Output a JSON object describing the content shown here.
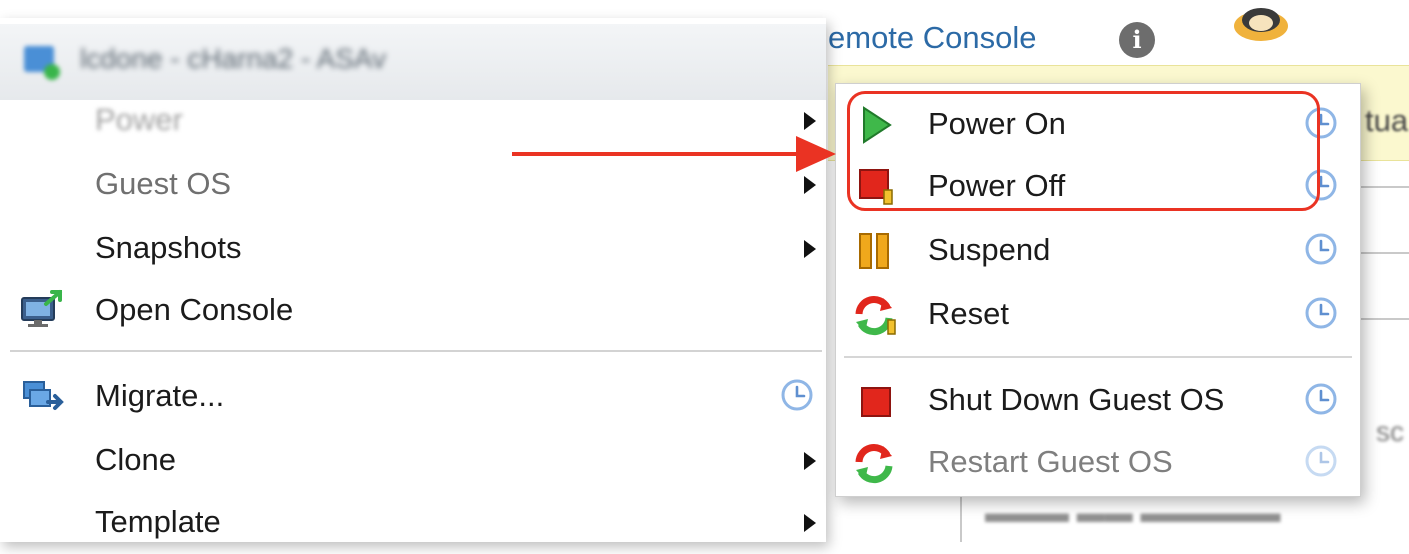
{
  "background": {
    "console_link": "emote Console",
    "info_icon": "info-circle-icon",
    "avatar_icon": "user-avatar-icon",
    "banner_text_fragment": "tua",
    "faded_text_fragment": "sc"
  },
  "context_menu": {
    "header": {
      "vm_icon": "virtual-machine-icon",
      "title": "lcdone - cHarna2 - ASAv"
    },
    "items": [
      {
        "label": "Power",
        "has_submenu": true,
        "state": "blurred"
      },
      {
        "label": "Guest OS",
        "has_submenu": true,
        "state": "disabled"
      },
      {
        "label": "Snapshots",
        "has_submenu": true,
        "state": "normal"
      },
      {
        "label": "Open Console",
        "icon": "console-icon",
        "state": "normal"
      },
      {
        "label": "Migrate...",
        "icon": "migrate-icon",
        "has_clock": true,
        "state": "normal"
      },
      {
        "label": "Clone",
        "has_submenu": true,
        "state": "normal"
      },
      {
        "label": "Template",
        "has_submenu": true,
        "state": "normal"
      }
    ]
  },
  "power_submenu": {
    "items": [
      {
        "label": "Power On",
        "icon": "play-icon"
      },
      {
        "label": "Power Off",
        "icon": "stop-icon"
      },
      {
        "label": "Suspend",
        "icon": "pause-icon"
      },
      {
        "label": "Reset",
        "icon": "reset-icon"
      },
      {
        "label": "Shut Down Guest OS",
        "icon": "shutdown-icon"
      },
      {
        "label": "Restart Guest OS",
        "icon": "restart-icon",
        "state": "faded"
      }
    ],
    "clock_icon": "clock-icon"
  },
  "colors": {
    "annotation_red": "#ea3323",
    "link_blue": "#2c6aa6",
    "banner_yellow": "#fbf8cf",
    "clock_blue": "#8fb6e6"
  }
}
